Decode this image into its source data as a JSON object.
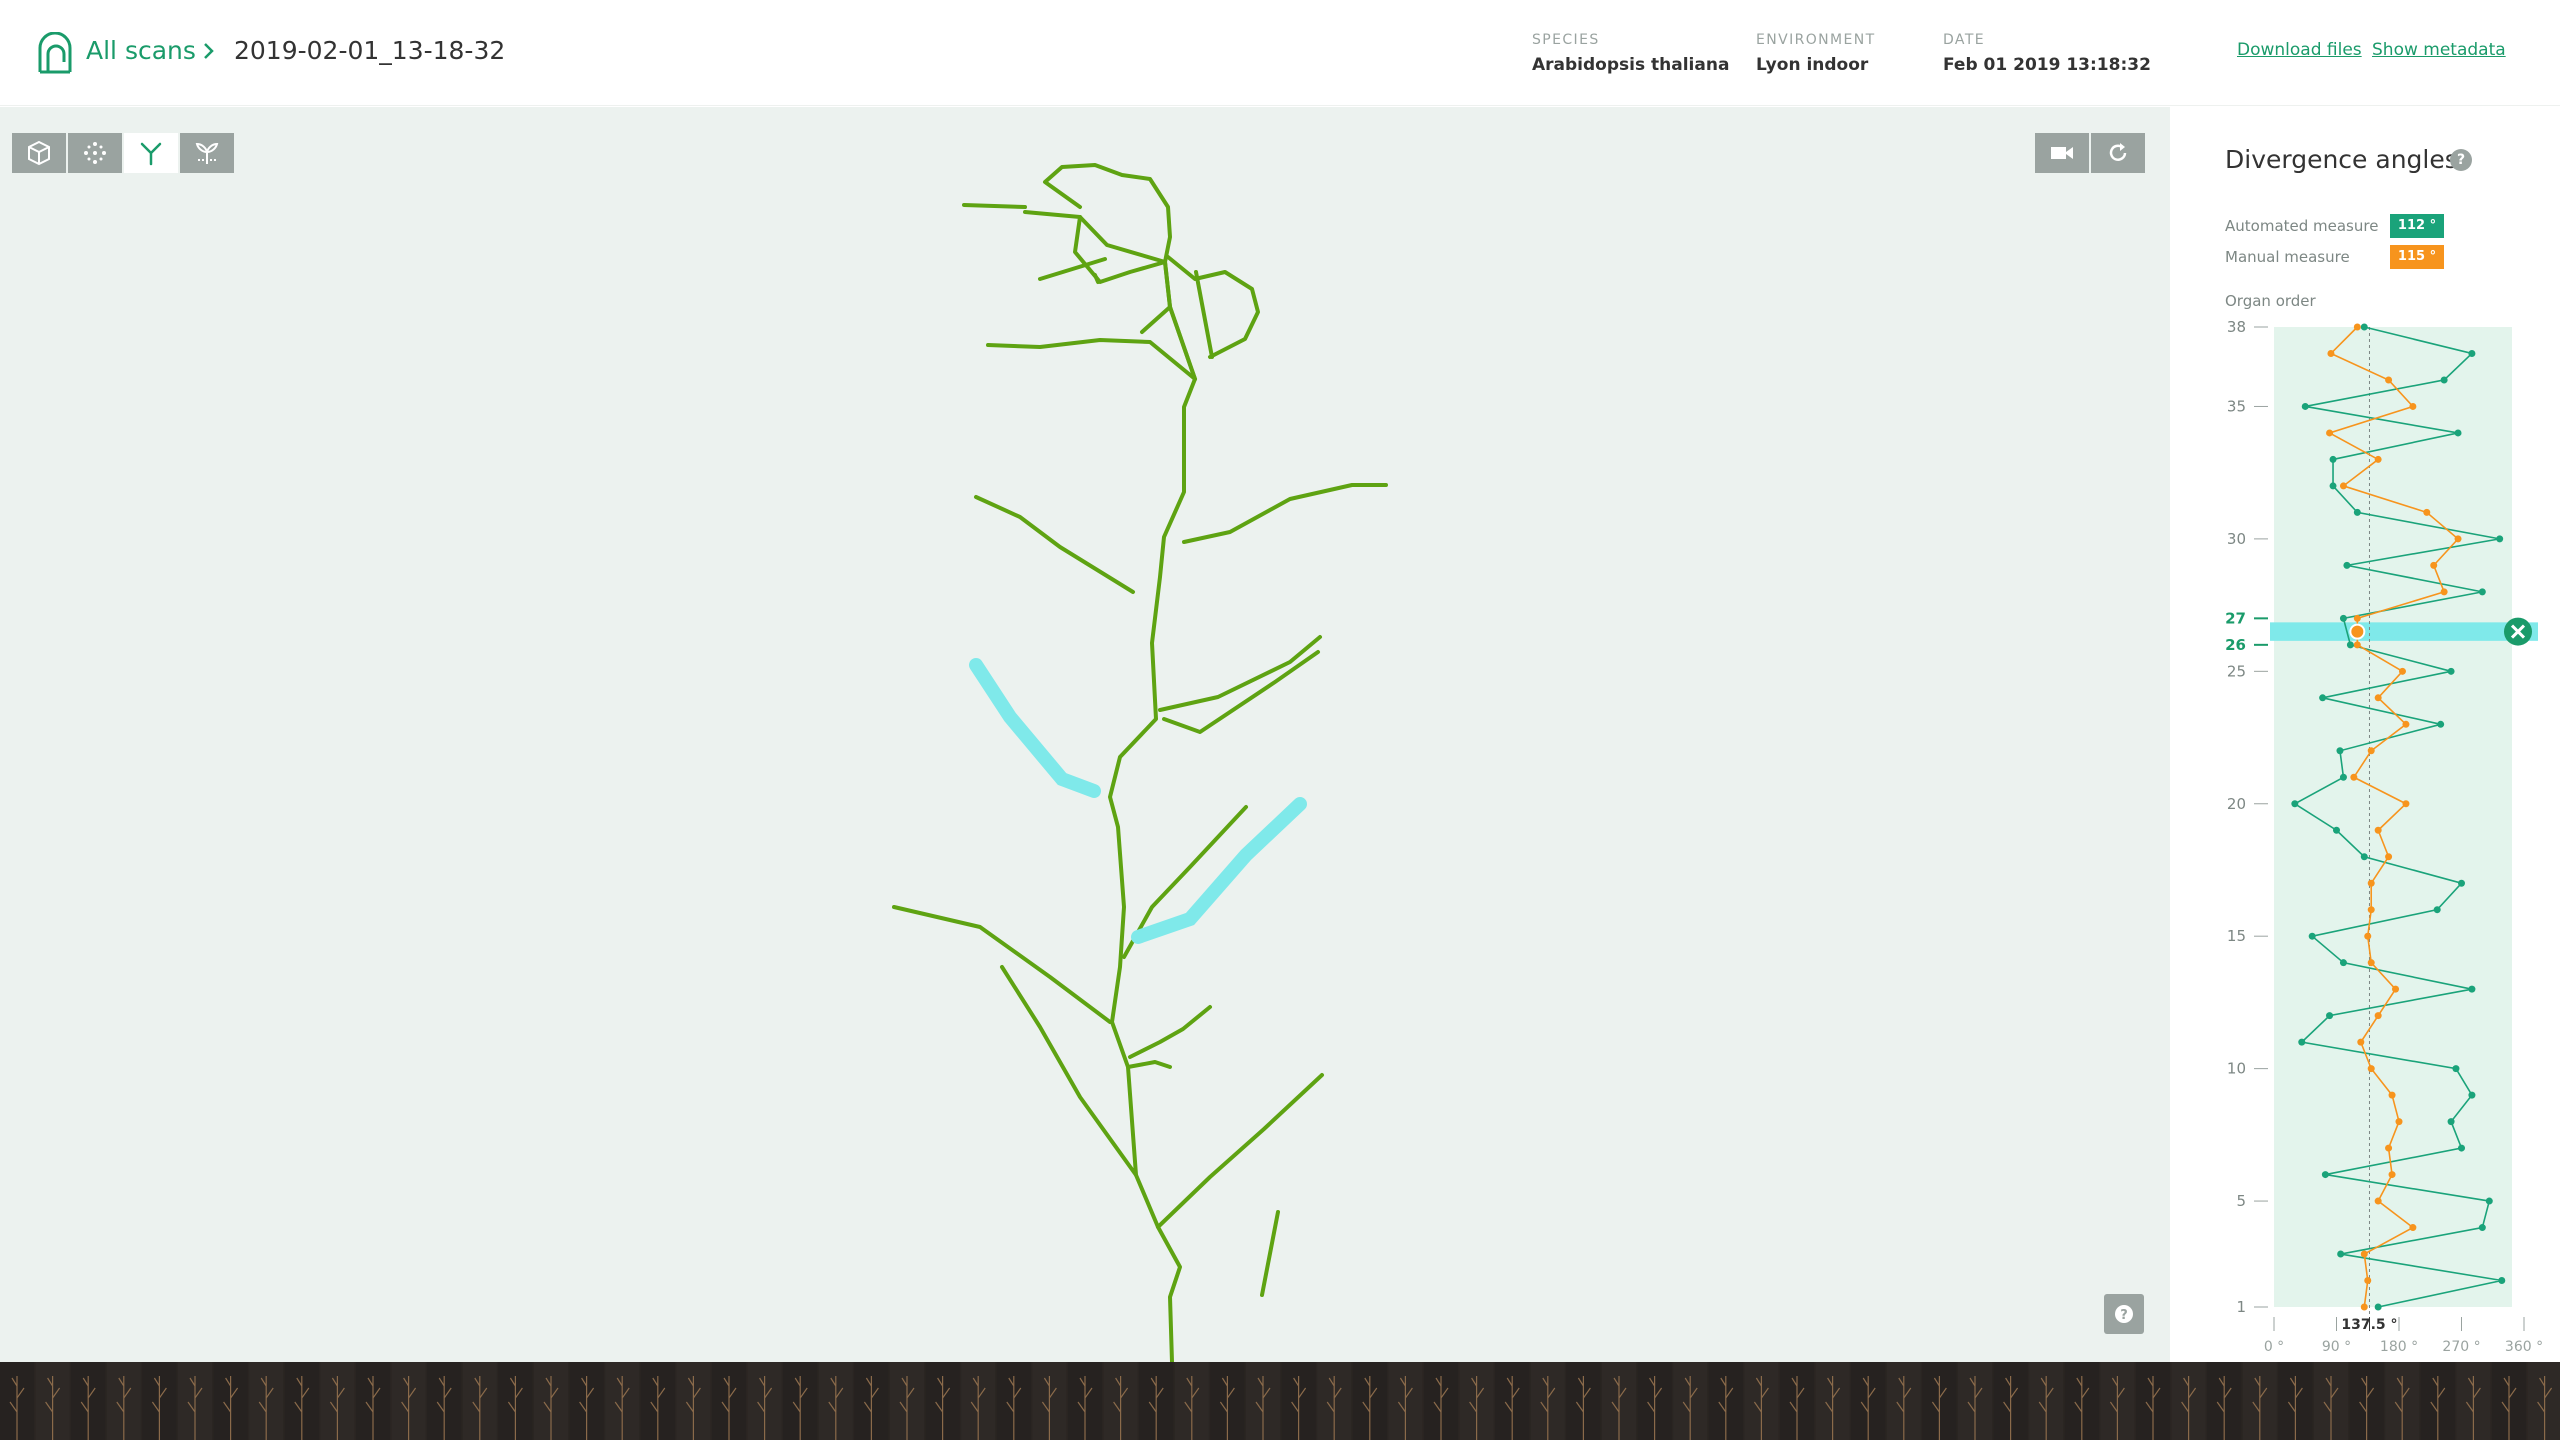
{
  "header": {
    "all_scans": "All scans",
    "scan_name": "2019-02-01_13-18-32",
    "meta": [
      {
        "label": "SPECIES",
        "value": "Arabidopsis thaliana"
      },
      {
        "label": "ENVIRONMENT",
        "value": "Lyon indoor"
      },
      {
        "label": "DATE",
        "value": "Feb 01 2019 13:18:32"
      }
    ],
    "download": "Download files",
    "show_metadata": "Show metadata"
  },
  "viewer": {
    "tools": [
      "mesh-icon",
      "point-cloud-icon",
      "skeleton-icon",
      "organs-icon"
    ],
    "active_tool": 2,
    "camera_tools": [
      "camera-icon",
      "reset-view-icon"
    ],
    "help": "?"
  },
  "panel": {
    "title": "Divergence angles",
    "help": "?",
    "automated_label": "Automated measure",
    "automated_value": "112 °",
    "manual_label": "Manual measure",
    "manual_value": "115 °",
    "organ_order": "Organ order"
  },
  "colors": {
    "accent": "#1a9b6a",
    "automated": "#1aa37a",
    "manual": "#f7941d",
    "highlight": "#7fe9ea",
    "stem": "#5ea312",
    "viewer_bg": "#ecf2ef",
    "tool_gray": "#9aa3a0"
  },
  "chart_data": {
    "type": "line",
    "title": "",
    "xlabel": "",
    "ylabel": "Organ order",
    "xlim": [
      0,
      360
    ],
    "ylim": [
      1,
      38
    ],
    "x_ticks": [
      "0 °",
      "90 °",
      "180 °",
      "270 °",
      "360 °"
    ],
    "y_ticks": [
      1,
      5,
      10,
      15,
      20,
      25,
      30,
      35,
      38
    ],
    "highlighted_ticks": [
      26,
      27
    ],
    "reference_label": "137.5 °",
    "reference_value": 137.5,
    "highlighted_interval": [
      26,
      27
    ],
    "series": [
      {
        "name": "Automated measure",
        "y": [
          1,
          2,
          3,
          4,
          5,
          6,
          7,
          8,
          9,
          10,
          11,
          12,
          13,
          14,
          15,
          16,
          17,
          18,
          19,
          20,
          21,
          22,
          23,
          24,
          25,
          26,
          27,
          28,
          29,
          30,
          31,
          32,
          33,
          34,
          35,
          36,
          37,
          38
        ],
        "x": [
          150,
          328,
          96,
          300,
          310,
          74,
          270,
          255,
          285,
          262,
          40,
          80,
          285,
          100,
          55,
          235,
          270,
          130,
          90,
          30,
          100,
          95,
          240,
          70,
          255,
          110,
          100,
          300,
          105,
          325,
          120,
          85,
          85,
          265,
          45,
          245,
          285,
          130
        ]
      },
      {
        "name": "Manual measure",
        "y": [
          1,
          2,
          3,
          4,
          5,
          6,
          7,
          8,
          9,
          10,
          11,
          12,
          13,
          14,
          15,
          16,
          17,
          18,
          19,
          20,
          21,
          22,
          23,
          24,
          25,
          26,
          27,
          28,
          29,
          30,
          31,
          32,
          33,
          34,
          35,
          36,
          37,
          38
        ],
        "x": [
          130,
          135,
          130,
          200,
          150,
          170,
          165,
          180,
          170,
          140,
          125,
          150,
          175,
          140,
          135,
          140,
          140,
          165,
          150,
          190,
          115,
          140,
          190,
          150,
          185,
          120,
          120,
          245,
          230,
          265,
          220,
          100,
          150,
          80,
          200,
          165,
          82,
          120
        ]
      }
    ]
  }
}
